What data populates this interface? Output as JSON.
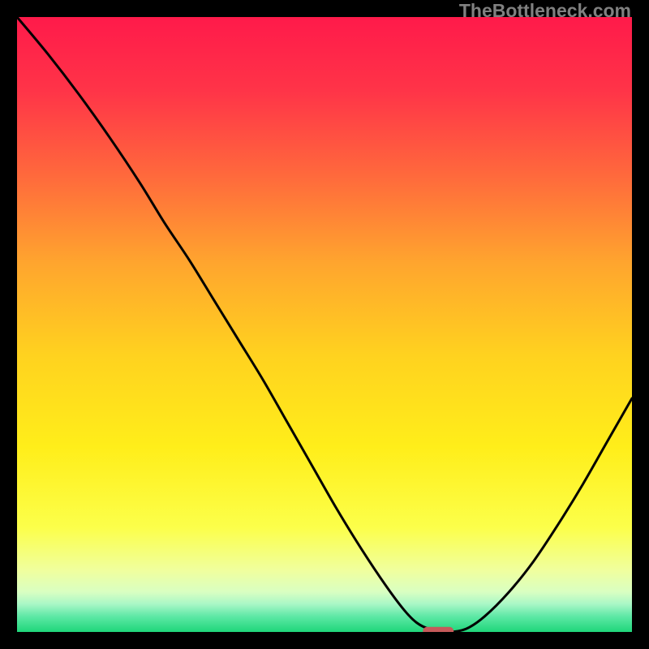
{
  "watermark": "TheBottleneck.com",
  "chart_data": {
    "type": "line",
    "title": "",
    "xlabel": "",
    "ylabel": "",
    "xlim": [
      0,
      100
    ],
    "ylim": [
      0,
      100
    ],
    "grid": false,
    "legend": false,
    "gradient_stops": [
      {
        "offset": 0.0,
        "color": "#ff1a4a"
      },
      {
        "offset": 0.12,
        "color": "#ff3448"
      },
      {
        "offset": 0.26,
        "color": "#ff6a3c"
      },
      {
        "offset": 0.4,
        "color": "#ffa52e"
      },
      {
        "offset": 0.55,
        "color": "#ffd21f"
      },
      {
        "offset": 0.7,
        "color": "#ffee1a"
      },
      {
        "offset": 0.83,
        "color": "#fcff4a"
      },
      {
        "offset": 0.9,
        "color": "#f0ff9e"
      },
      {
        "offset": 0.935,
        "color": "#d9ffc2"
      },
      {
        "offset": 0.955,
        "color": "#a8f7c6"
      },
      {
        "offset": 0.975,
        "color": "#5de8a5"
      },
      {
        "offset": 1.0,
        "color": "#1fd67a"
      }
    ],
    "series": [
      {
        "name": "bottleneck-curve",
        "color": "#000000",
        "x": [
          0.0,
          5,
          10,
          15,
          20,
          24,
          28,
          32,
          36,
          40,
          44,
          48,
          52,
          56,
          60,
          63,
          65,
          67,
          70,
          73,
          76,
          80,
          84,
          88,
          92,
          96,
          100
        ],
        "values": [
          100,
          94,
          87.5,
          80.5,
          73,
          66.5,
          60.5,
          54,
          47.5,
          41,
          34,
          27,
          20,
          13.5,
          7.5,
          3.5,
          1.5,
          0.5,
          0.0,
          0.5,
          2.5,
          6.5,
          11.5,
          17.5,
          24,
          31,
          38
        ]
      }
    ],
    "marker": {
      "name": "optimal-point-marker",
      "x": 68.5,
      "y": 0,
      "width_pct": 5.0,
      "height_pct": 1.4,
      "fill": "#c65a5a"
    }
  }
}
